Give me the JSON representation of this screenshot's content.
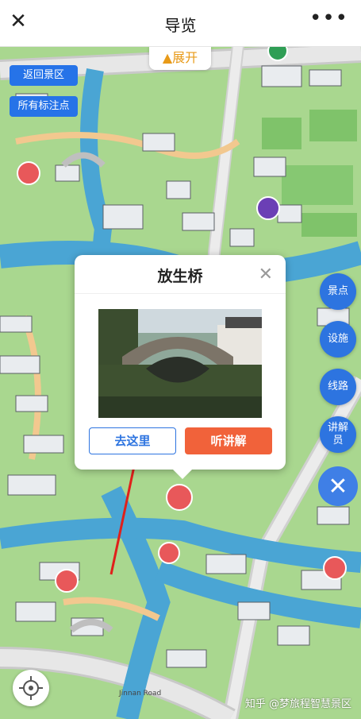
{
  "header": {
    "title": "导览",
    "close_icon": "close-icon",
    "more_icon": "more-icon"
  },
  "map": {
    "expand_label": "展开",
    "back_label": "返回景区",
    "markers_label": "所有标注点",
    "road_label": "Jinnan Road"
  },
  "side": {
    "spots": "景点",
    "facilities": "设施",
    "routes": "线路",
    "guide": "讲解员"
  },
  "popup": {
    "title": "放生桥",
    "go_label": "去这里",
    "listen_label": "听讲解"
  },
  "watermark": "知乎 @梦旅程智慧景区",
  "colors": {
    "accent_blue": "#2d74e0",
    "accent_orange": "#f1623a",
    "marker_red": "#e8585a"
  }
}
